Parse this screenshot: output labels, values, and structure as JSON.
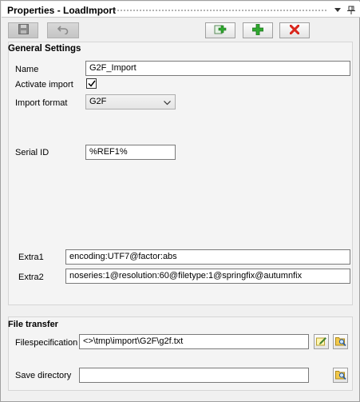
{
  "window": {
    "title": "Properties - LoadImport"
  },
  "toolbar": {
    "save_icon": "save-icon",
    "undo_icon": "undo-icon",
    "copy_add_icon": "copy-add-icon",
    "add_icon": "add-icon",
    "delete_icon": "delete-icon"
  },
  "general": {
    "title": "General Settings",
    "name_label": "Name",
    "name_value": "G2F_Import",
    "activate_label": "Activate import",
    "activate_checked": true,
    "format_label": "Import format",
    "format_value": "G2F",
    "serial_label": "Serial ID",
    "serial_value": "%REF1%",
    "extra1_label": "Extra1",
    "extra1_value": "encoding:UTF7@factor:abs",
    "extra2_label": "Extra2",
    "extra2_value": "noseries:1@resolution:60@filetype:1@springfix@autumnfix"
  },
  "file_transfer": {
    "title": "File transfer",
    "filespec_label": "Filespecification",
    "filespec_value": "<>\\tmp\\import\\G2F\\g2f.txt",
    "savedir_label": "Save directory",
    "savedir_value": ""
  },
  "colors": {
    "delete_red": "#d9261c",
    "add_green": "#2fa82f"
  }
}
